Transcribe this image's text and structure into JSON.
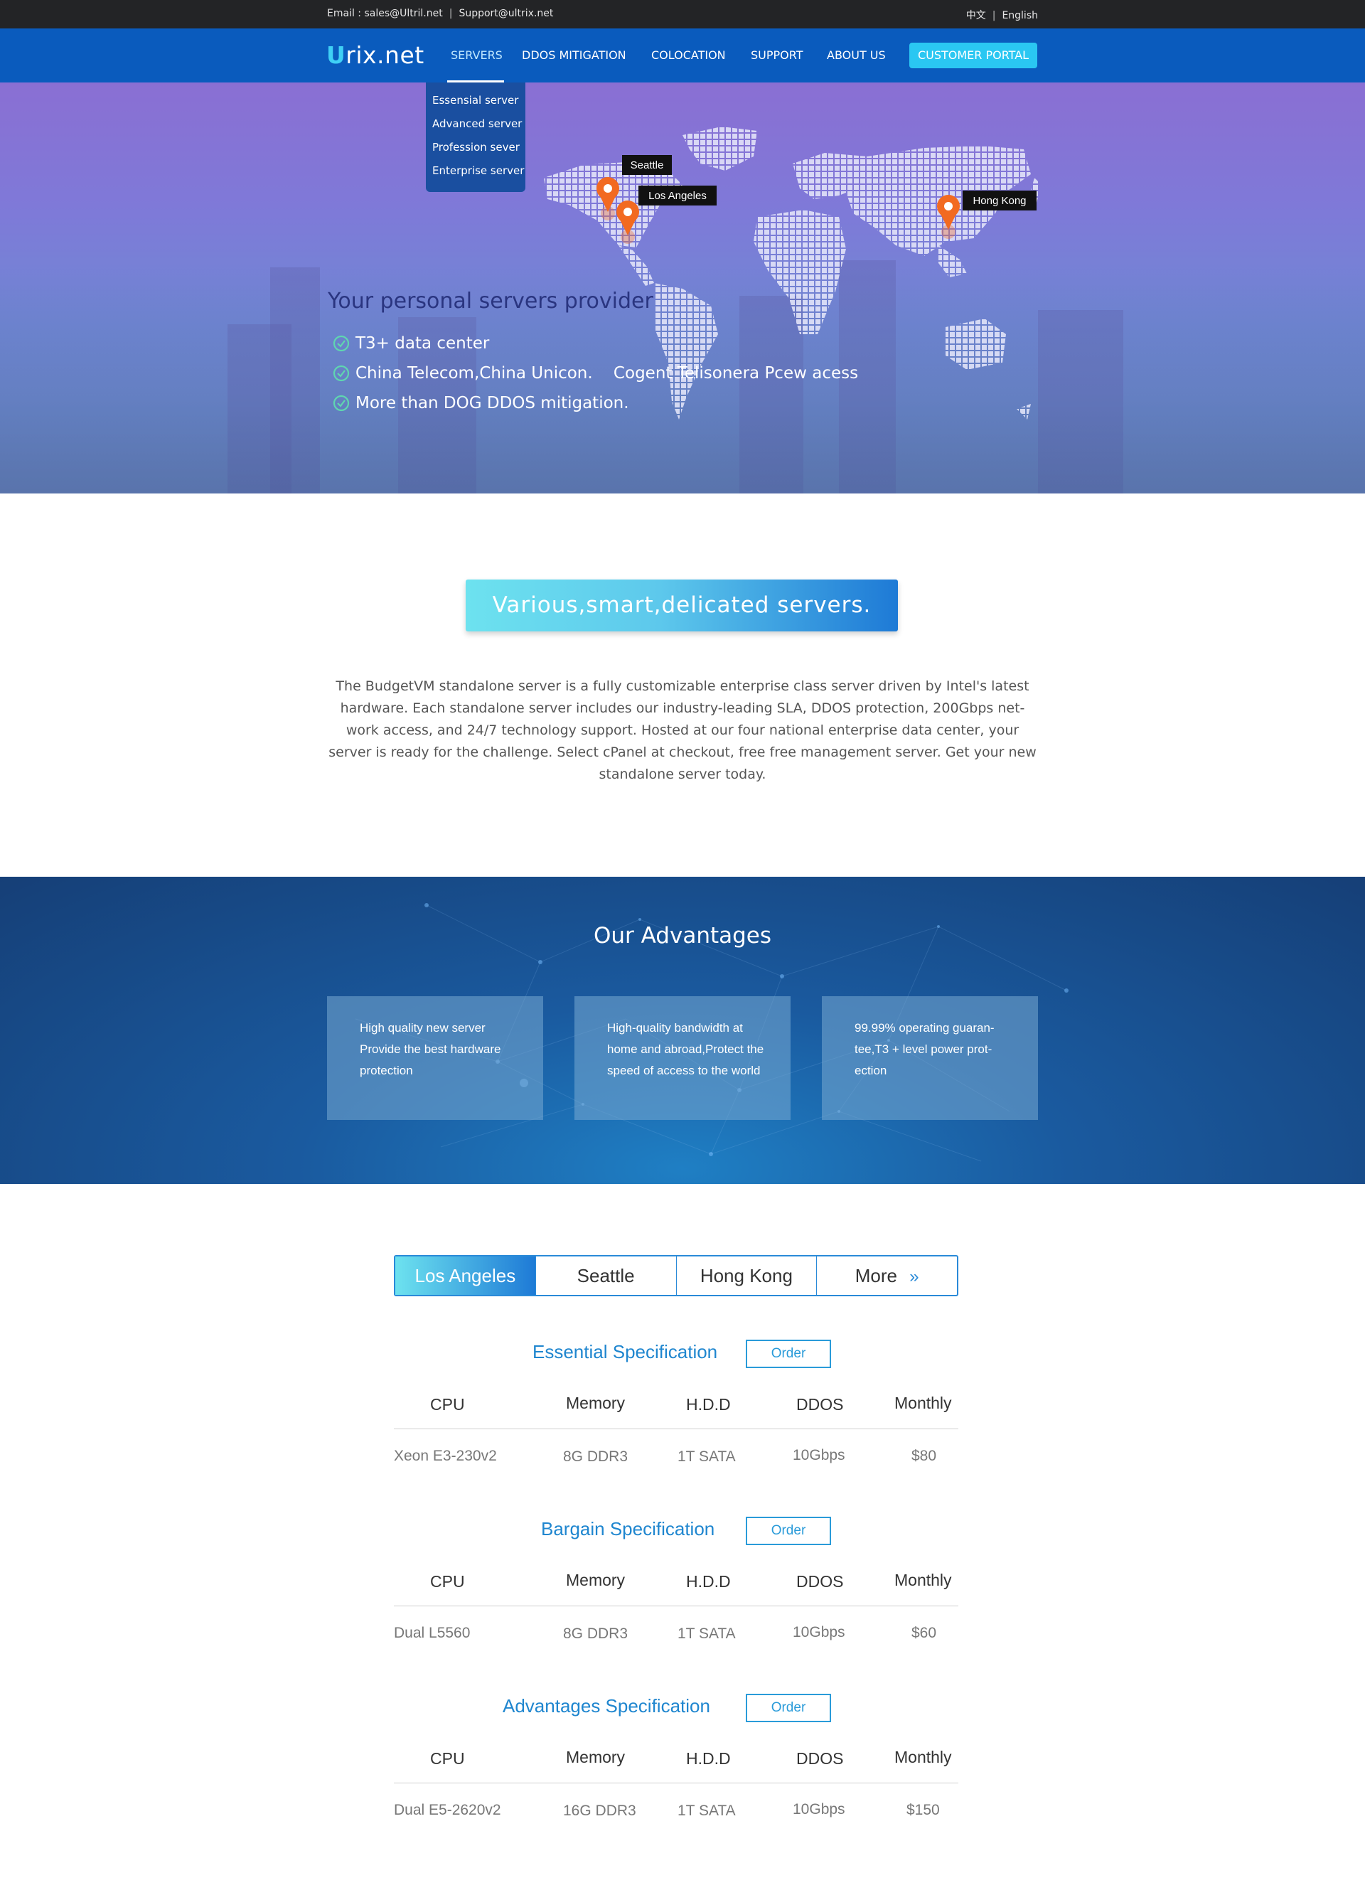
{
  "topbar": {
    "email_text": "Email : sales@Ultril.net",
    "support_text": "Support@ultrix.net",
    "lang_cn": "中文",
    "lang_en": "English"
  },
  "nav": {
    "logo_u": "U",
    "logo_rest": "rix.net",
    "items": [
      "SERVERS",
      "DDOS MITIGATION",
      "COLOCATION",
      "SUPPORT",
      "ABOUT US"
    ],
    "portal": "CUSTOMER PORTAL",
    "dropdown": [
      "Essensial server",
      "Advanced server",
      "Profession sever",
      "Enterprise server"
    ]
  },
  "hero": {
    "title": "Your personal servers provider",
    "features": [
      "T3+ data center",
      "China Telecom,China Unicon.    Cogent Telisonera Pcew acess",
      "More than DOG DDOS mitigation."
    ],
    "locations": [
      "Seattle",
      "Los Angeles",
      "Hong Kong"
    ],
    "accent": "#f26a21"
  },
  "intro": {
    "pill": "Various,smart,delicated servers.",
    "text": "The BudgetVM standalone server is a fully customizable enterprise class server driven by Intel's latest hardware. Each standalone server includes our industry-leading SLA, DDOS protection, 200Gbps net-work access, and 24/7 technology support. Hosted at our four national enterprise data center, your server is ready for the challenge. Select cPanel at checkout, free free management server. Get your new standalone server today."
  },
  "advantages": {
    "title": "Our Advantages",
    "cards": [
      "High quality new server Provide the best hardware protection",
      "High-quality bandwidth at home and abroad,Protect the speed of access to the world",
      "99.99% operating guaran-tee,T3 + level power prot-ection"
    ]
  },
  "tabs": [
    "Los Angeles",
    "Seattle",
    "Hong Kong",
    "More"
  ],
  "spec_headers": [
    "CPU",
    "Memory",
    "H.D.D",
    "DDOS",
    "Monthly"
  ],
  "order_label": "Order",
  "specs": [
    {
      "title": "Essential Specification",
      "row": [
        "Xeon E3-230v2",
        "8G DDR3",
        "1T SATA",
        "10Gbps",
        "$80"
      ]
    },
    {
      "title": "Bargain Specification",
      "row": [
        "Dual L5560",
        "8G DDR3",
        "1T SATA",
        "10Gbps",
        "$60"
      ]
    },
    {
      "title": "Advantages Specification",
      "row": [
        "Dual E5-2620v2",
        "16G DDR3",
        "1T SATA",
        "10Gbps",
        "$150"
      ]
    }
  ]
}
